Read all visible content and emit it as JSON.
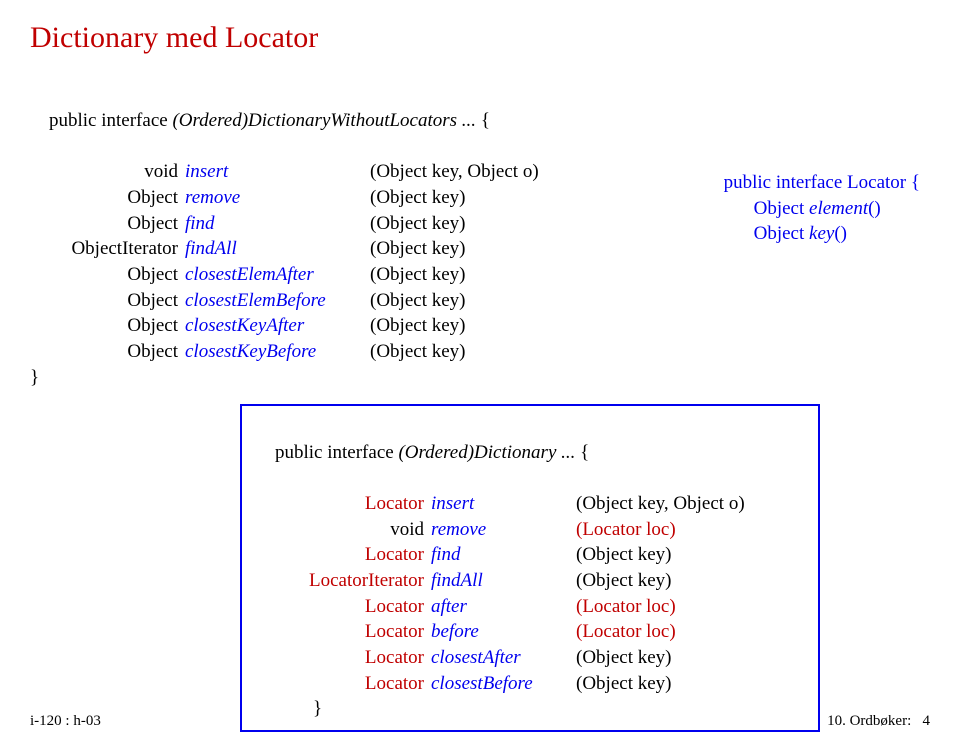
{
  "title": "Dictionary med Locator",
  "intro_prefix": "public interface ",
  "intro_name": "(Ordered)DictionaryWithoutLocators ... ",
  "intro_brace": "{",
  "close_brace": "}",
  "block1": [
    {
      "type": "void",
      "name": "insert",
      "arg": "(Object key, Object o)"
    },
    {
      "type": "Object",
      "name": "remove",
      "arg": "(Object key)"
    },
    {
      "type": "Object",
      "name": "find",
      "arg": "(Object key)"
    },
    {
      "type": "ObjectIterator",
      "name": "findAll",
      "arg": "(Object key)"
    },
    {
      "type": "Object",
      "name": "closestElemAfter",
      "arg": "(Object key)"
    },
    {
      "type": "Object",
      "name": "closestElemBefore",
      "arg": "(Object key)"
    },
    {
      "type": "Object",
      "name": "closestKeyAfter",
      "arg": "(Object key)"
    },
    {
      "type": "Object",
      "name": "closestKeyBefore",
      "arg": "(Object key)"
    }
  ],
  "locator": {
    "line1": "public interface Locator {",
    "m1_type": "Object ",
    "m1_name": "element",
    "m1_paren": "()",
    "m2_type": "Object ",
    "m2_name": "key",
    "m2_paren": "()"
  },
  "block2_intro_prefix": "public interface ",
  "block2_intro_name": "(Ordered)Dictionary ... ",
  "block2_intro_brace": "{",
  "block2": [
    {
      "type": "Locator",
      "type_color": "red",
      "name": "insert",
      "arg": "(Object key, Object o)",
      "arg_color": "black"
    },
    {
      "type": "void",
      "type_color": "black",
      "name": "remove",
      "arg": "(Locator loc)",
      "arg_color": "red"
    },
    {
      "type": "Locator",
      "type_color": "red",
      "name": "find",
      "arg": "(Object key)",
      "arg_color": "black"
    },
    {
      "type": "LocatorIterator",
      "type_color": "red",
      "name": "findAll",
      "arg": "(Object key)",
      "arg_color": "black"
    },
    {
      "type": "Locator",
      "type_color": "red",
      "name": "after",
      "arg": "(Locator loc)",
      "arg_color": "red"
    },
    {
      "type": "Locator",
      "type_color": "red",
      "name": "before",
      "arg": "(Locator loc)",
      "arg_color": "red"
    },
    {
      "type": "Locator",
      "type_color": "red",
      "name": "closestAfter",
      "arg": "(Object key)",
      "arg_color": "black"
    },
    {
      "type": "Locator",
      "type_color": "red",
      "name": "closestBefore",
      "arg": "(Object key)",
      "arg_color": "black"
    }
  ],
  "block2_close_indent": "            ",
  "footer_left": "i-120 : h-03",
  "footer_right_label": "10. Ordbøker:",
  "footer_right_page": "4"
}
